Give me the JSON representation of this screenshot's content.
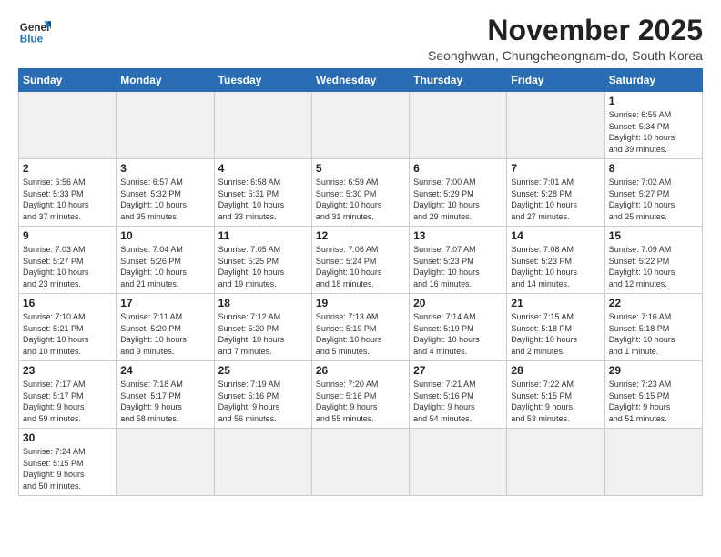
{
  "header": {
    "logo_general": "General",
    "logo_blue": "Blue",
    "month_title": "November 2025",
    "subtitle": "Seonghwan, Chungcheongnam-do, South Korea"
  },
  "weekdays": [
    "Sunday",
    "Monday",
    "Tuesday",
    "Wednesday",
    "Thursday",
    "Friday",
    "Saturday"
  ],
  "weeks": [
    [
      {
        "day": "",
        "info": "",
        "empty": true
      },
      {
        "day": "",
        "info": "",
        "empty": true
      },
      {
        "day": "",
        "info": "",
        "empty": true
      },
      {
        "day": "",
        "info": "",
        "empty": true
      },
      {
        "day": "",
        "info": "",
        "empty": true
      },
      {
        "day": "",
        "info": "",
        "empty": true
      },
      {
        "day": "1",
        "info": "Sunrise: 6:55 AM\nSunset: 5:34 PM\nDaylight: 10 hours\nand 39 minutes."
      }
    ],
    [
      {
        "day": "2",
        "info": "Sunrise: 6:56 AM\nSunset: 5:33 PM\nDaylight: 10 hours\nand 37 minutes."
      },
      {
        "day": "3",
        "info": "Sunrise: 6:57 AM\nSunset: 5:32 PM\nDaylight: 10 hours\nand 35 minutes."
      },
      {
        "day": "4",
        "info": "Sunrise: 6:58 AM\nSunset: 5:31 PM\nDaylight: 10 hours\nand 33 minutes."
      },
      {
        "day": "5",
        "info": "Sunrise: 6:59 AM\nSunset: 5:30 PM\nDaylight: 10 hours\nand 31 minutes."
      },
      {
        "day": "6",
        "info": "Sunrise: 7:00 AM\nSunset: 5:29 PM\nDaylight: 10 hours\nand 29 minutes."
      },
      {
        "day": "7",
        "info": "Sunrise: 7:01 AM\nSunset: 5:28 PM\nDaylight: 10 hours\nand 27 minutes."
      },
      {
        "day": "8",
        "info": "Sunrise: 7:02 AM\nSunset: 5:27 PM\nDaylight: 10 hours\nand 25 minutes."
      }
    ],
    [
      {
        "day": "9",
        "info": "Sunrise: 7:03 AM\nSunset: 5:27 PM\nDaylight: 10 hours\nand 23 minutes."
      },
      {
        "day": "10",
        "info": "Sunrise: 7:04 AM\nSunset: 5:26 PM\nDaylight: 10 hours\nand 21 minutes."
      },
      {
        "day": "11",
        "info": "Sunrise: 7:05 AM\nSunset: 5:25 PM\nDaylight: 10 hours\nand 19 minutes."
      },
      {
        "day": "12",
        "info": "Sunrise: 7:06 AM\nSunset: 5:24 PM\nDaylight: 10 hours\nand 18 minutes."
      },
      {
        "day": "13",
        "info": "Sunrise: 7:07 AM\nSunset: 5:23 PM\nDaylight: 10 hours\nand 16 minutes."
      },
      {
        "day": "14",
        "info": "Sunrise: 7:08 AM\nSunset: 5:23 PM\nDaylight: 10 hours\nand 14 minutes."
      },
      {
        "day": "15",
        "info": "Sunrise: 7:09 AM\nSunset: 5:22 PM\nDaylight: 10 hours\nand 12 minutes."
      }
    ],
    [
      {
        "day": "16",
        "info": "Sunrise: 7:10 AM\nSunset: 5:21 PM\nDaylight: 10 hours\nand 10 minutes."
      },
      {
        "day": "17",
        "info": "Sunrise: 7:11 AM\nSunset: 5:20 PM\nDaylight: 10 hours\nand 9 minutes."
      },
      {
        "day": "18",
        "info": "Sunrise: 7:12 AM\nSunset: 5:20 PM\nDaylight: 10 hours\nand 7 minutes."
      },
      {
        "day": "19",
        "info": "Sunrise: 7:13 AM\nSunset: 5:19 PM\nDaylight: 10 hours\nand 5 minutes."
      },
      {
        "day": "20",
        "info": "Sunrise: 7:14 AM\nSunset: 5:19 PM\nDaylight: 10 hours\nand 4 minutes."
      },
      {
        "day": "21",
        "info": "Sunrise: 7:15 AM\nSunset: 5:18 PM\nDaylight: 10 hours\nand 2 minutes."
      },
      {
        "day": "22",
        "info": "Sunrise: 7:16 AM\nSunset: 5:18 PM\nDaylight: 10 hours\nand 1 minute."
      }
    ],
    [
      {
        "day": "23",
        "info": "Sunrise: 7:17 AM\nSunset: 5:17 PM\nDaylight: 9 hours\nand 59 minutes."
      },
      {
        "day": "24",
        "info": "Sunrise: 7:18 AM\nSunset: 5:17 PM\nDaylight: 9 hours\nand 58 minutes."
      },
      {
        "day": "25",
        "info": "Sunrise: 7:19 AM\nSunset: 5:16 PM\nDaylight: 9 hours\nand 56 minutes."
      },
      {
        "day": "26",
        "info": "Sunrise: 7:20 AM\nSunset: 5:16 PM\nDaylight: 9 hours\nand 55 minutes."
      },
      {
        "day": "27",
        "info": "Sunrise: 7:21 AM\nSunset: 5:16 PM\nDaylight: 9 hours\nand 54 minutes."
      },
      {
        "day": "28",
        "info": "Sunrise: 7:22 AM\nSunset: 5:15 PM\nDaylight: 9 hours\nand 53 minutes."
      },
      {
        "day": "29",
        "info": "Sunrise: 7:23 AM\nSunset: 5:15 PM\nDaylight: 9 hours\nand 51 minutes."
      }
    ],
    [
      {
        "day": "30",
        "info": "Sunrise: 7:24 AM\nSunset: 5:15 PM\nDaylight: 9 hours\nand 50 minutes."
      },
      {
        "day": "",
        "info": "",
        "empty": true
      },
      {
        "day": "",
        "info": "",
        "empty": true
      },
      {
        "day": "",
        "info": "",
        "empty": true
      },
      {
        "day": "",
        "info": "",
        "empty": true
      },
      {
        "day": "",
        "info": "",
        "empty": true
      },
      {
        "day": "",
        "info": "",
        "empty": true
      }
    ]
  ]
}
